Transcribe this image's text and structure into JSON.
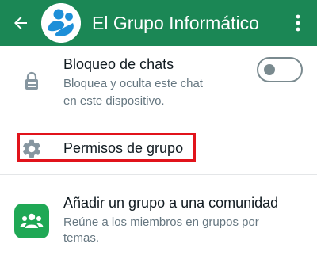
{
  "header": {
    "title": "El Grupo Informático",
    "back_icon": "arrow-left-icon",
    "more_icon": "more-vert-icon",
    "background_color": "#1b8755"
  },
  "settings": {
    "chat_lock": {
      "title": "Bloqueo de chats",
      "subtitle_line1": "Bloquea y oculta este chat",
      "subtitle_line2": "en este dispositivo.",
      "icon": "lock-icon",
      "toggle_on": false
    },
    "group_permissions": {
      "title": "Permisos de grupo",
      "icon": "gear-icon",
      "highlight_color": "#e1131b"
    },
    "add_to_community": {
      "title": "Añadir un grupo a una comunidad",
      "subtitle_line1": "Reúne a los miembros en grupos por",
      "subtitle_line2": "temas.",
      "icon": "community-icon",
      "icon_color": "#1fa855"
    }
  }
}
